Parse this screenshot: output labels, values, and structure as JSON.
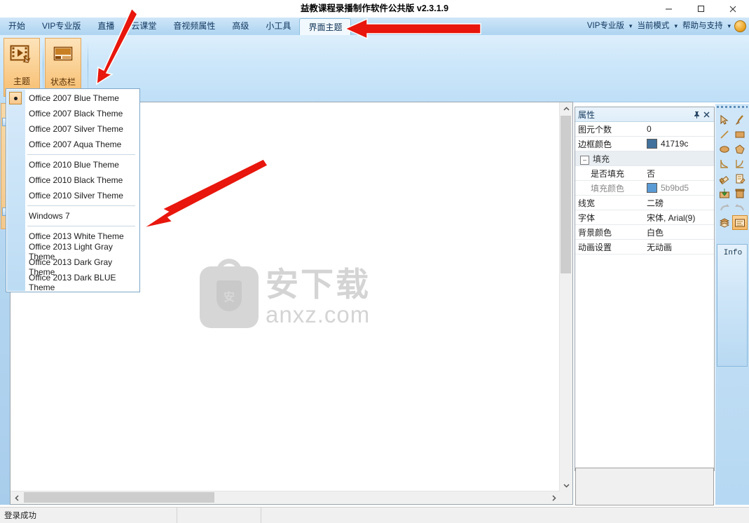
{
  "window": {
    "title": "益教课程录播制作软件公共版 v2.3.1.9",
    "minimize_label": "—",
    "maximize_label": "☐",
    "close_label": "✕"
  },
  "ribbon": {
    "tabs": [
      {
        "label": "开始",
        "active": false
      },
      {
        "label": "VIP专业版",
        "active": false
      },
      {
        "label": "直播",
        "active": false
      },
      {
        "label": "云课堂",
        "active": false
      },
      {
        "label": "音视频属性",
        "active": false
      },
      {
        "label": "高级",
        "active": false
      },
      {
        "label": "小工具",
        "active": false
      },
      {
        "label": "界面主题",
        "active": true
      }
    ],
    "right_items": [
      {
        "label": "VIP专业版"
      },
      {
        "label": "当前模式"
      },
      {
        "label": "帮助与支持"
      }
    ],
    "caret": "▾",
    "help_icon": "help-orb-icon",
    "buttons": [
      {
        "label": "主题",
        "icon": "theme-film-icon",
        "caret": "▾"
      },
      {
        "label": "状态栏",
        "icon": "statusbar-icon",
        "caret": ""
      }
    ]
  },
  "theme_menu": {
    "selected_index": 0,
    "items": [
      {
        "label": "Office 2007 Blue Theme",
        "checked": true,
        "sep_after": false
      },
      {
        "label": "Office 2007 Black Theme",
        "checked": false,
        "sep_after": false
      },
      {
        "label": "Office 2007 Silver Theme",
        "checked": false,
        "sep_after": false
      },
      {
        "label": "Office 2007 Aqua Theme",
        "checked": false,
        "sep_after": true
      },
      {
        "label": "Office 2010 Blue Theme",
        "checked": false,
        "sep_after": false
      },
      {
        "label": "Office 2010 Black Theme",
        "checked": false,
        "sep_after": false
      },
      {
        "label": "Office 2010 Silver Theme",
        "checked": false,
        "sep_after": true
      },
      {
        "label": "Windows 7",
        "checked": false,
        "sep_after": true
      },
      {
        "label": "Office 2013 White Theme",
        "checked": false,
        "sep_after": false
      },
      {
        "label": "Office 2013 Light Gray Theme",
        "checked": false,
        "sep_after": false
      },
      {
        "label": "Office 2013 Dark Gray Theme",
        "checked": false,
        "sep_after": false
      },
      {
        "label": "Office 2013 Dark BLUE Theme",
        "checked": false,
        "sep_after": false
      }
    ]
  },
  "canvas": {
    "watermark_cn": "安下载",
    "watermark_en": "anxz.com",
    "watermark_badge_char": "安",
    "scroll_up": "⌃",
    "scroll_down": "⌄",
    "scroll_left": "‹",
    "scroll_right": "›"
  },
  "properties": {
    "title": "属性",
    "pin_icon": "pin-icon",
    "close_icon": "close-icon",
    "rows": [
      {
        "name": "图元个数",
        "value": "0",
        "type": "text",
        "indent": 0,
        "group": false,
        "dim": false
      },
      {
        "name": "边框颜色",
        "value": "41719c",
        "type": "color",
        "color": "#41719c",
        "indent": 0,
        "group": false,
        "dim": false
      },
      {
        "name": "填充",
        "value": "",
        "type": "group",
        "indent": 0,
        "group": true,
        "dim": false,
        "expander": "⊟"
      },
      {
        "name": "是否填充",
        "value": "否",
        "type": "text",
        "indent": 1,
        "group": false,
        "dim": false
      },
      {
        "name": "填充颜色",
        "value": "5b9bd5",
        "type": "color",
        "color": "#5b9bd5",
        "indent": 1,
        "group": false,
        "dim": true
      },
      {
        "name": "线宽",
        "value": "二磅",
        "type": "text",
        "indent": 0,
        "group": false,
        "dim": false
      },
      {
        "name": "字体",
        "value": "宋体, Arial(9)",
        "type": "text",
        "indent": 0,
        "group": false,
        "dim": false
      },
      {
        "name": "背景颜色",
        "value": "白色",
        "type": "text",
        "indent": 0,
        "group": false,
        "dim": false
      },
      {
        "name": "动画设置",
        "value": "无动画",
        "type": "text",
        "indent": 0,
        "group": false,
        "dim": false
      }
    ]
  },
  "tool_palette": {
    "tools": [
      {
        "icon": "cursor-select-icon",
        "selected": false
      },
      {
        "icon": "brush-icon",
        "selected": false
      },
      {
        "icon": "line-icon",
        "selected": false
      },
      {
        "icon": "rectangle-icon",
        "selected": false
      },
      {
        "icon": "ellipse-icon",
        "selected": false
      },
      {
        "icon": "polygon-icon",
        "selected": false
      },
      {
        "icon": "curve-left-icon",
        "selected": false
      },
      {
        "icon": "curve-right-icon",
        "selected": false
      },
      {
        "icon": "eraser-icon",
        "selected": false
      },
      {
        "icon": "page-edit-icon",
        "selected": false
      },
      {
        "icon": "import-icon",
        "selected": false
      },
      {
        "icon": "trash-icon",
        "selected": false
      },
      {
        "icon": "redo-icon",
        "selected": false
      },
      {
        "icon": "undo-icon",
        "selected": false
      },
      {
        "icon": "layers-icon",
        "selected": false
      },
      {
        "icon": "whiteboard-icon",
        "selected": true
      }
    ],
    "info_tab_label": "Info"
  },
  "statusbar": {
    "message": "登录成功",
    "cell2": "",
    "cell3": ""
  },
  "colors": {
    "accent_blue": "#bcdcf4",
    "ribbon_orange": "#f7bd6f",
    "annotation_red": "#e8160c",
    "selection_border": "#d08b2a"
  }
}
